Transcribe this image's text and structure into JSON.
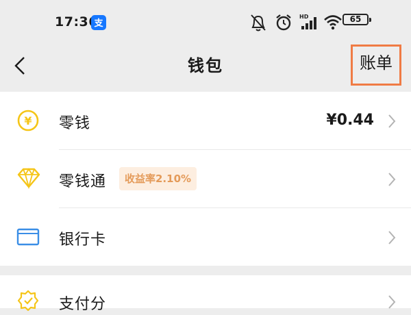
{
  "status_bar": {
    "time": "17:36",
    "battery": "65",
    "network_badge": "HD"
  },
  "nav": {
    "title": "钱包",
    "bill_label": "账单"
  },
  "wallet": {
    "items": [
      {
        "label": "零钱",
        "value": "¥0.44",
        "icon": "yuan-coin-icon"
      },
      {
        "label": "零钱通",
        "badge": "收益率2.10%",
        "icon": "diamond-icon"
      },
      {
        "label": "银行卡",
        "icon": "bank-card-icon"
      },
      {
        "label": "支付分",
        "icon": "pay-score-icon"
      }
    ]
  },
  "colors": {
    "highlight_border": "#f07b44",
    "icon_yellow": "#f5c518",
    "icon_blue": "#3a8ee6",
    "badge_bg": "#fdeee0",
    "badge_text": "#e49b5a"
  }
}
